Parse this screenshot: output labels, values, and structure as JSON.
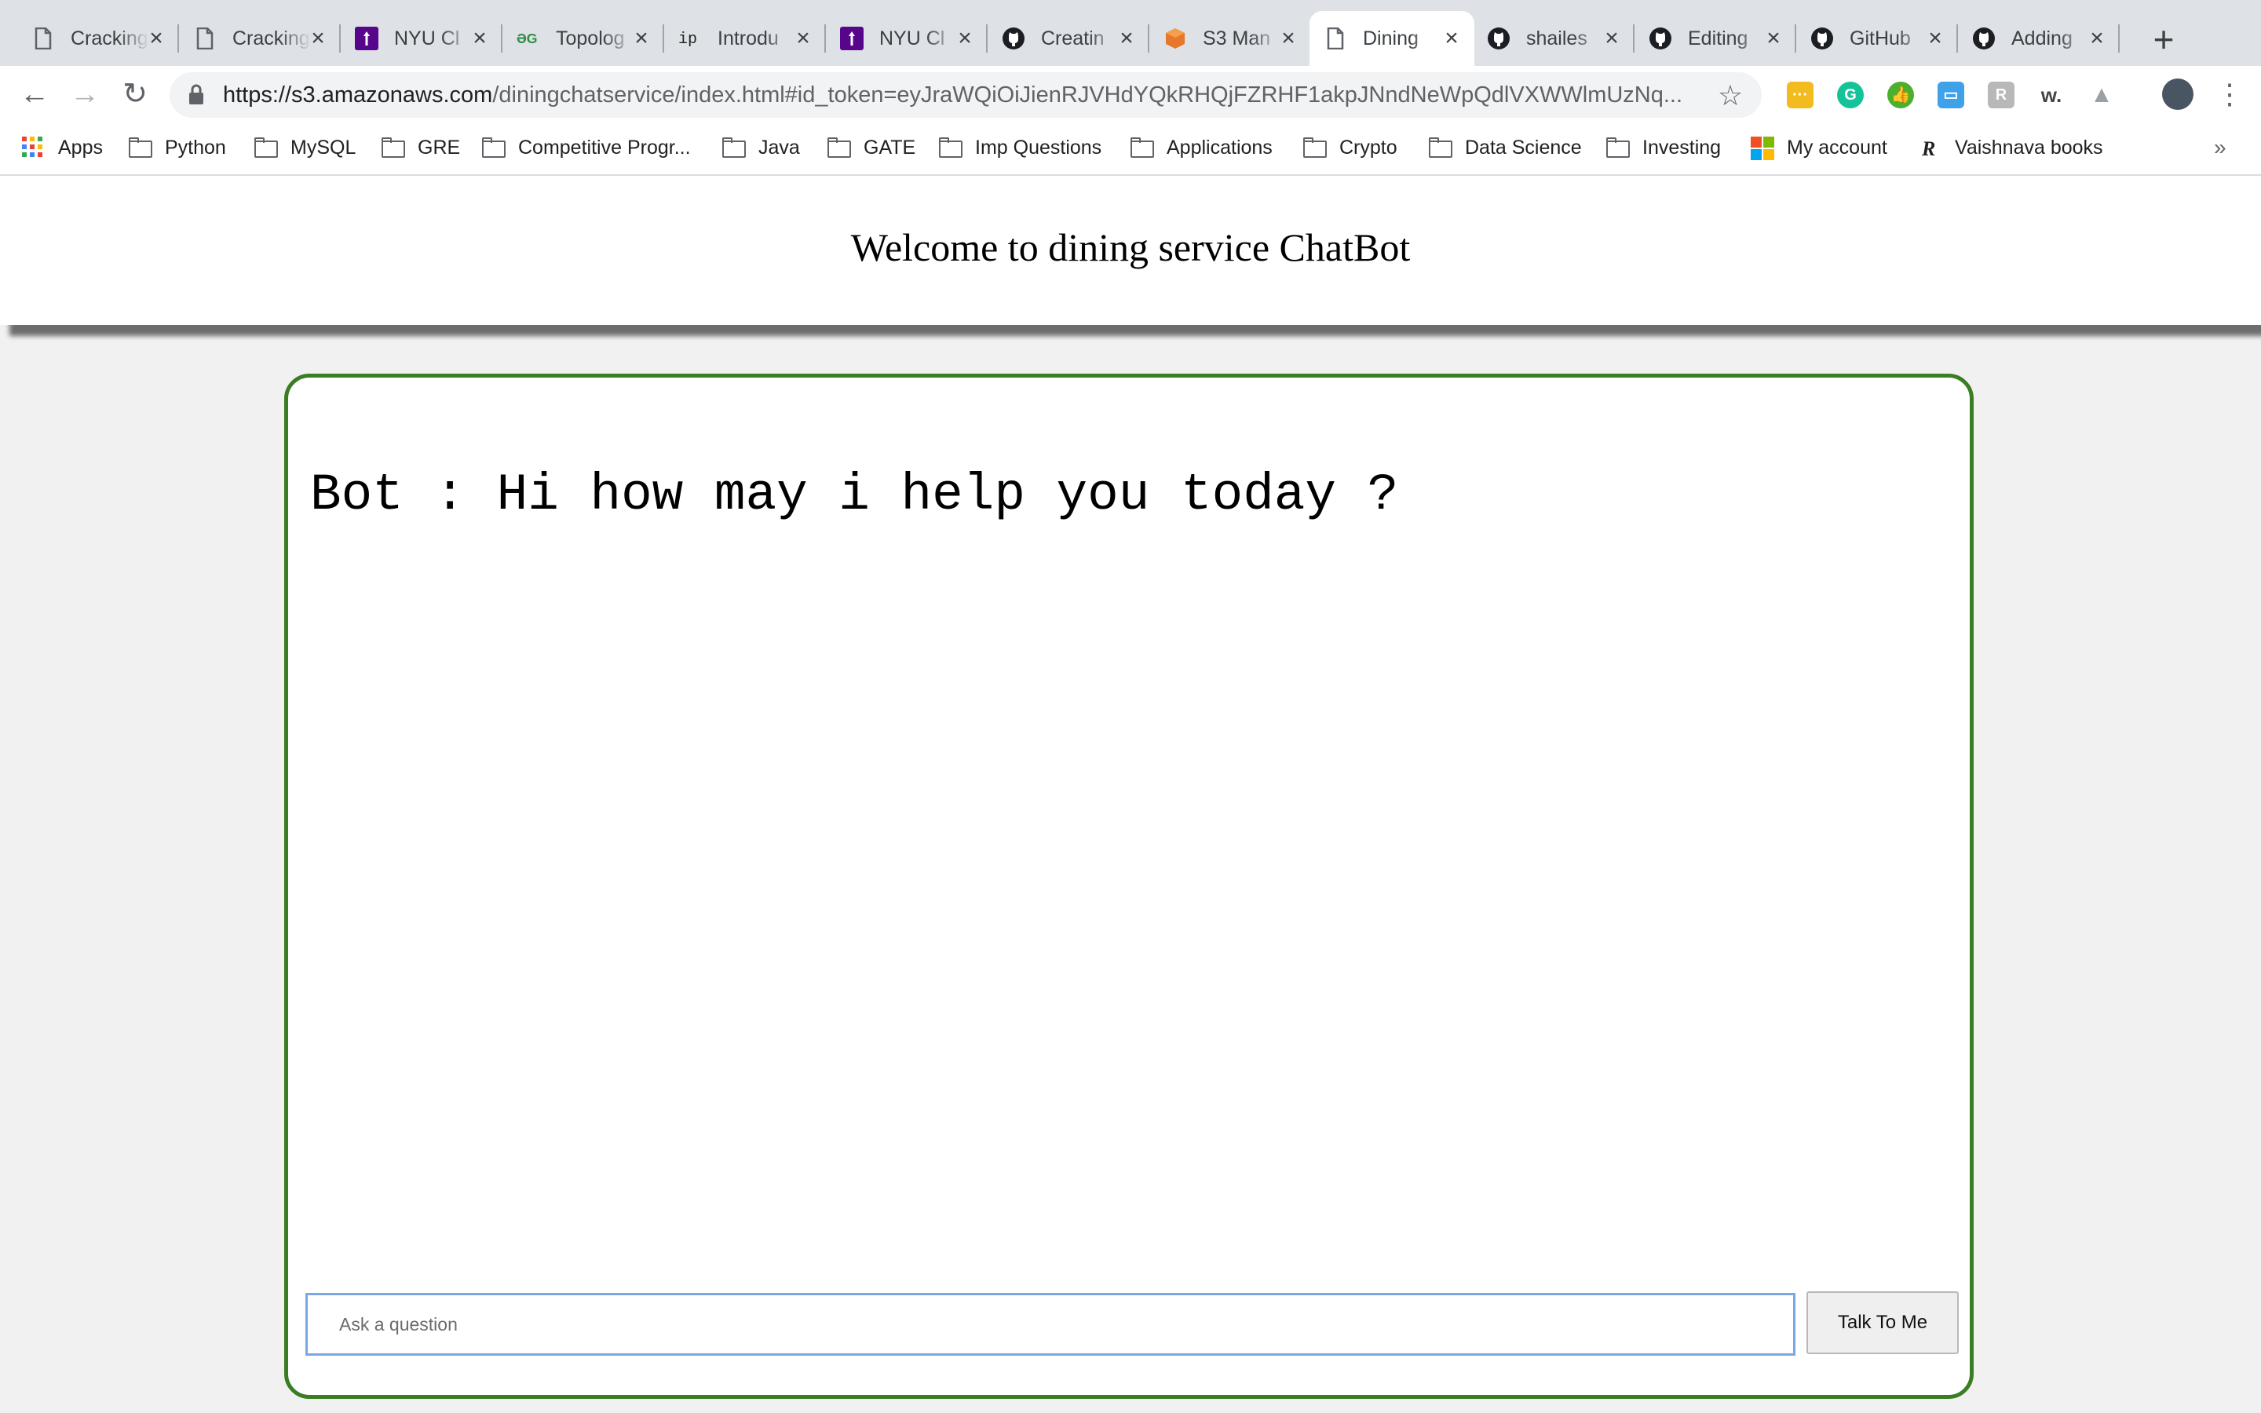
{
  "browser": {
    "tabs": [
      {
        "title": "Cracking",
        "favicon": "page-icon",
        "active": false
      },
      {
        "title": "Cracking",
        "favicon": "page-icon",
        "active": false
      },
      {
        "title": "NYU Cl",
        "favicon": "nyu-torch-icon",
        "active": false
      },
      {
        "title": "Topolog",
        "favicon": "geeksforgeeks-icon",
        "active": false
      },
      {
        "title": "Introdu",
        "favicon": "ip-icon",
        "active": false
      },
      {
        "title": "NYU Cl",
        "favicon": "nyu-torch-icon",
        "active": false
      },
      {
        "title": "Creatin",
        "favicon": "github-icon",
        "active": false
      },
      {
        "title": "S3 Man",
        "favicon": "aws-s3-icon",
        "active": false
      },
      {
        "title": "Dining",
        "favicon": "page-icon",
        "active": true
      },
      {
        "title": "shailes",
        "favicon": "github-icon",
        "active": false
      },
      {
        "title": "Editing",
        "favicon": "github-icon",
        "active": false
      },
      {
        "title": "GitHub",
        "favicon": "github-icon",
        "active": false
      },
      {
        "title": "Adding",
        "favicon": "github-icon",
        "active": false
      }
    ],
    "close_glyph": "×",
    "new_tab_glyph": "+",
    "url_host": "https://s3.amazonaws.com",
    "url_rest": "/diningchatservice/index.html#id_token=eyJraWQiOiJienRJVHdYQkRHQjFZRHF1akpJNndNeWpQdlVXWWlmUzNq...",
    "back_glyph": "←",
    "forward_glyph": "→",
    "reload_glyph": "↻",
    "star_glyph": "☆",
    "menu_glyph": "⋮",
    "extensions": [
      "dots-extension-icon",
      "grammarly-icon",
      "thumbs-up-extension-icon",
      "window-extension-icon",
      "r-extension-icon",
      "w-extension-icon",
      "drive-icon",
      "profile-avatar"
    ],
    "bookmarks": [
      {
        "label": "Apps",
        "icon": "apps-grid-icon"
      },
      {
        "label": "Python",
        "icon": "folder-icon"
      },
      {
        "label": "MySQL",
        "icon": "folder-icon"
      },
      {
        "label": "GRE",
        "icon": "folder-icon"
      },
      {
        "label": "Competitive Progr...",
        "icon": "folder-icon"
      },
      {
        "label": "Java",
        "icon": "folder-icon"
      },
      {
        "label": "GATE",
        "icon": "folder-icon"
      },
      {
        "label": "Imp Questions",
        "icon": "folder-icon"
      },
      {
        "label": "Applications",
        "icon": "folder-icon"
      },
      {
        "label": "Crypto",
        "icon": "folder-icon"
      },
      {
        "label": "Data Science",
        "icon": "folder-icon"
      },
      {
        "label": "Investing",
        "icon": "folder-icon"
      },
      {
        "label": "My account",
        "icon": "microsoft-icon"
      },
      {
        "label": "Vaishnava books",
        "icon": "r-logo-icon"
      }
    ],
    "bookmarks_more": "»"
  },
  "page": {
    "title": "Welcome to dining service ChatBot",
    "messages": [
      {
        "text": "Bot : Hi how may i help you today ?"
      }
    ],
    "input": {
      "placeholder": "Ask a question",
      "value": ""
    },
    "send_button": "Talk To Me"
  },
  "colors": {
    "chat_border": "#3a7d23",
    "input_focus": "#7aa7e6"
  }
}
